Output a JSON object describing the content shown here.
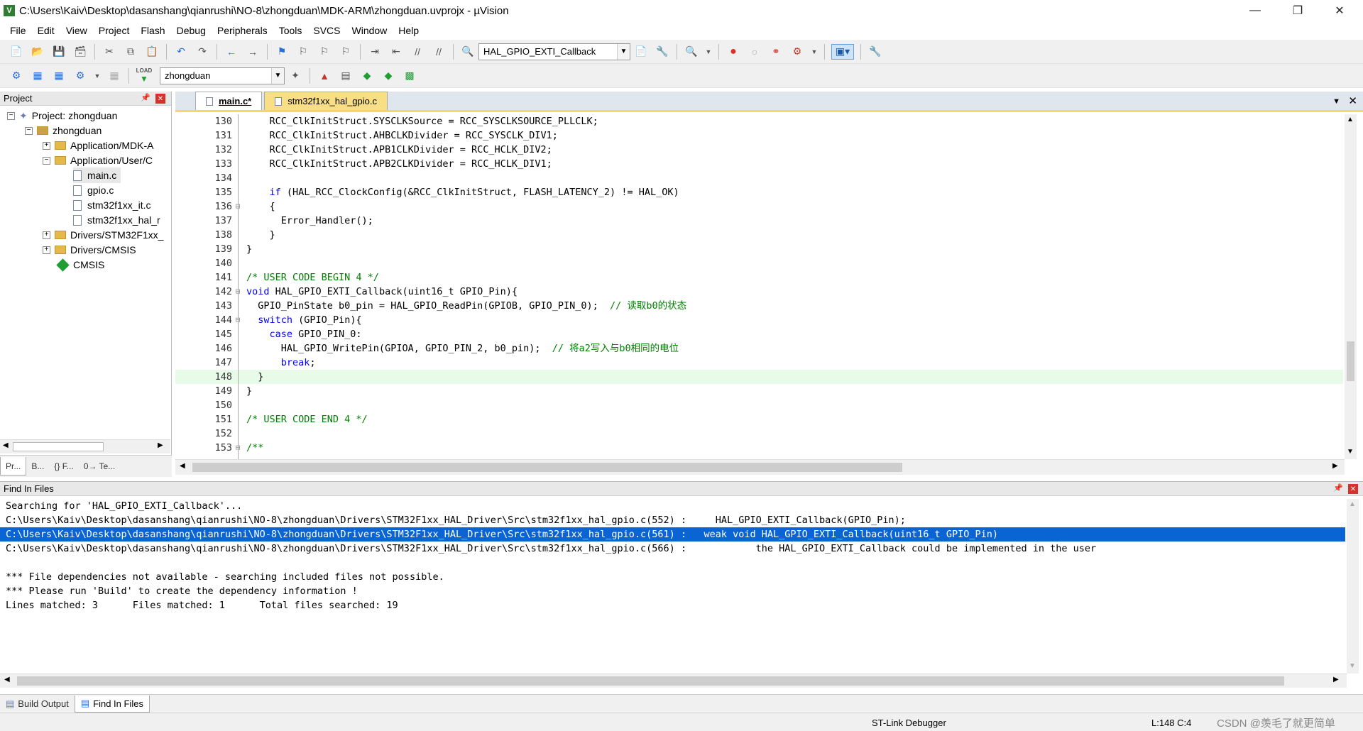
{
  "window": {
    "title": "C:\\Users\\Kaiv\\Desktop\\dasanshang\\qianrushi\\NO-8\\zhongduan\\MDK-ARM\\zhongduan.uvprojx - µVision"
  },
  "menu": [
    "File",
    "Edit",
    "View",
    "Project",
    "Flash",
    "Debug",
    "Peripherals",
    "Tools",
    "SVCS",
    "Window",
    "Help"
  ],
  "toolbar": {
    "find_combo": "HAL_GPIO_EXTI_Callback",
    "target_combo": "zhongduan",
    "load_label": "LOAD"
  },
  "project": {
    "title": "Project",
    "root": "Project: zhongduan",
    "target": "zhongduan",
    "groups": [
      {
        "label": "Application/MDK-A",
        "expanded": false
      },
      {
        "label": "Application/User/C",
        "expanded": true
      },
      {
        "label": "Drivers/STM32F1xx_",
        "expanded": false
      },
      {
        "label": "Drivers/CMSIS",
        "expanded": false
      },
      {
        "label": "CMSIS",
        "expanded": false
      }
    ],
    "files": [
      "main.c",
      "gpio.c",
      "stm32f1xx_it.c",
      "stm32f1xx_hal_r"
    ],
    "tabs": [
      "Pr...",
      "B...",
      "{} F...",
      "0→ Te..."
    ]
  },
  "editor": {
    "tabs": [
      "main.c*",
      "stm32f1xx_hal_gpio.c"
    ],
    "active_line": 148,
    "lines": [
      {
        "n": "130",
        "f": "",
        "t": "    RCC_ClkInitStruct.SYSCLKSource = RCC_SYSCLKSOURCE_PLLCLK;"
      },
      {
        "n": "131",
        "f": "",
        "t": "    RCC_ClkInitStruct.AHBCLKDivider = RCC_SYSCLK_DIV1;"
      },
      {
        "n": "132",
        "f": "",
        "t": "    RCC_ClkInitStruct.APB1CLKDivider = RCC_HCLK_DIV2;"
      },
      {
        "n": "133",
        "f": "",
        "t": "    RCC_ClkInitStruct.APB2CLKDivider = RCC_HCLK_DIV1;"
      },
      {
        "n": "134",
        "f": "",
        "t": ""
      },
      {
        "n": "135",
        "f": "",
        "t": "    if (HAL_RCC_ClockConfig(&RCC_ClkInitStruct, FLASH_LATENCY_2) != HAL_OK)"
      },
      {
        "n": "136",
        "f": "⊟",
        "t": "    {"
      },
      {
        "n": "137",
        "f": "",
        "t": "      Error_Handler();"
      },
      {
        "n": "138",
        "f": "",
        "t": "    }"
      },
      {
        "n": "139",
        "f": "",
        "t": "}"
      },
      {
        "n": "140",
        "f": "",
        "t": ""
      },
      {
        "n": "141",
        "f": "",
        "t": "/* USER CODE BEGIN 4 */"
      },
      {
        "n": "142",
        "f": "⊟",
        "t": "void HAL_GPIO_EXTI_Callback(uint16_t GPIO_Pin){"
      },
      {
        "n": "143",
        "f": "",
        "t": "  GPIO_PinState b0_pin = HAL_GPIO_ReadPin(GPIOB, GPIO_PIN_0);  // 读取b0的状态"
      },
      {
        "n": "144",
        "f": "⊟",
        "t": "  switch (GPIO_Pin){"
      },
      {
        "n": "145",
        "f": "",
        "t": "    case GPIO_PIN_0:"
      },
      {
        "n": "146",
        "f": "",
        "t": "      HAL_GPIO_WritePin(GPIOA, GPIO_PIN_2, b0_pin);  // 将a2写入与b0相同的电位"
      },
      {
        "n": "147",
        "f": "",
        "t": "      break;"
      },
      {
        "n": "148",
        "f": "",
        "t": "  }"
      },
      {
        "n": "149",
        "f": "",
        "t": "}"
      },
      {
        "n": "150",
        "f": "",
        "t": ""
      },
      {
        "n": "151",
        "f": "",
        "t": "/* USER CODE END 4 */"
      },
      {
        "n": "152",
        "f": "",
        "t": ""
      },
      {
        "n": "153",
        "f": "⊟",
        "t": "/**"
      }
    ]
  },
  "find": {
    "title": "Find In Files",
    "lines": [
      "Searching for 'HAL_GPIO_EXTI_Callback'...",
      "C:\\Users\\Kaiv\\Desktop\\dasanshang\\qianrushi\\NO-8\\zhongduan\\Drivers\\STM32F1xx_HAL_Driver\\Src\\stm32f1xx_hal_gpio.c(552) :     HAL_GPIO_EXTI_Callback(GPIO_Pin);",
      "C:\\Users\\Kaiv\\Desktop\\dasanshang\\qianrushi\\NO-8\\zhongduan\\Drivers\\STM32F1xx_HAL_Driver\\Src\\stm32f1xx_hal_gpio.c(561) :   weak void HAL_GPIO_EXTI_Callback(uint16_t GPIO_Pin)",
      "C:\\Users\\Kaiv\\Desktop\\dasanshang\\qianrushi\\NO-8\\zhongduan\\Drivers\\STM32F1xx_HAL_Driver\\Src\\stm32f1xx_hal_gpio.c(566) :            the HAL_GPIO_EXTI_Callback could be implemented in the user",
      "",
      "*** File dependencies not available - searching included files not possible.",
      "*** Please run 'Build' to create the dependency information !",
      "Lines matched: 3      Files matched: 1      Total files searched: 19"
    ],
    "selected_index": 2
  },
  "bottom_tabs": [
    "Build Output",
    "Find In Files"
  ],
  "status": {
    "debugger": "ST-Link Debugger",
    "position": "L:148 C:4",
    "watermark": "CSDN @羡毛了就更简单"
  }
}
